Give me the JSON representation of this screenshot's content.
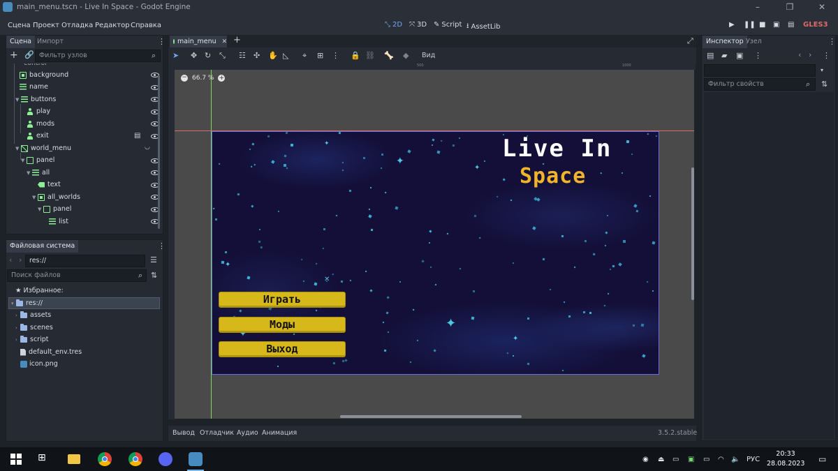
{
  "window": {
    "title": "main_menu.tscn - Live In Space - Godot Engine",
    "controls": [
      "–",
      "❐",
      "✕"
    ]
  },
  "menu": {
    "items": [
      "Сцена",
      "Проект",
      "Отладка",
      "Редактор",
      "Справка"
    ]
  },
  "workspaces": {
    "w2d": "2D",
    "w3d": "3D",
    "script": "Script",
    "assetlib": "AssetLib"
  },
  "renderer": "GLES3",
  "scene_panel": {
    "tabs": [
      "Сцена",
      "Импорт"
    ],
    "filter_placeholder": "Фильтр узлов",
    "nodes": [
      {
        "name": "control",
        "depth": 0
      },
      {
        "name": "background",
        "depth": 1
      },
      {
        "name": "name",
        "depth": 1
      },
      {
        "name": "buttons",
        "depth": 1
      },
      {
        "name": "play",
        "depth": 2
      },
      {
        "name": "mods",
        "depth": 2
      },
      {
        "name": "exit",
        "depth": 2
      },
      {
        "name": "world_menu",
        "depth": 1
      },
      {
        "name": "panel",
        "depth": 2
      },
      {
        "name": "all",
        "depth": 3
      },
      {
        "name": "text",
        "depth": 4
      },
      {
        "name": "all_worlds",
        "depth": 4
      },
      {
        "name": "panel",
        "depth": 5
      },
      {
        "name": "list",
        "depth": 6
      }
    ]
  },
  "filesystem": {
    "title": "Файловая система",
    "path": "res://",
    "search_placeholder": "Поиск файлов",
    "favorites": "Избранное:",
    "root": "res://",
    "items": [
      "assets",
      "scenes",
      "script",
      "default_env.tres",
      "icon.png"
    ]
  },
  "editor": {
    "tab": "main_menu",
    "zoom": "66.7 %",
    "view_menu": "Вид",
    "ruler_marks": [
      "500",
      "1000"
    ],
    "game": {
      "title_line1": "Live In",
      "title_line2": "Space",
      "buttons": [
        "Играть",
        "Моды",
        "Выход"
      ]
    }
  },
  "inspector": {
    "tabs": [
      "Инспектор",
      "Узел"
    ],
    "filter_placeholder": "Фильтр свойств"
  },
  "bottom": {
    "tabs": [
      "Вывод",
      "Отладчик",
      "Аудио",
      "Анимация"
    ],
    "version": "3.5.2.stable"
  },
  "taskbar": {
    "lang": "РУС",
    "time": "20:33",
    "date": "28.08.2023"
  },
  "colors": {
    "accent": "#6ea6f4",
    "node_green": "#8eef97",
    "button_yellow": "#d6b81a",
    "title_orange": "#f0b42a",
    "space_bg": "#130f38"
  }
}
